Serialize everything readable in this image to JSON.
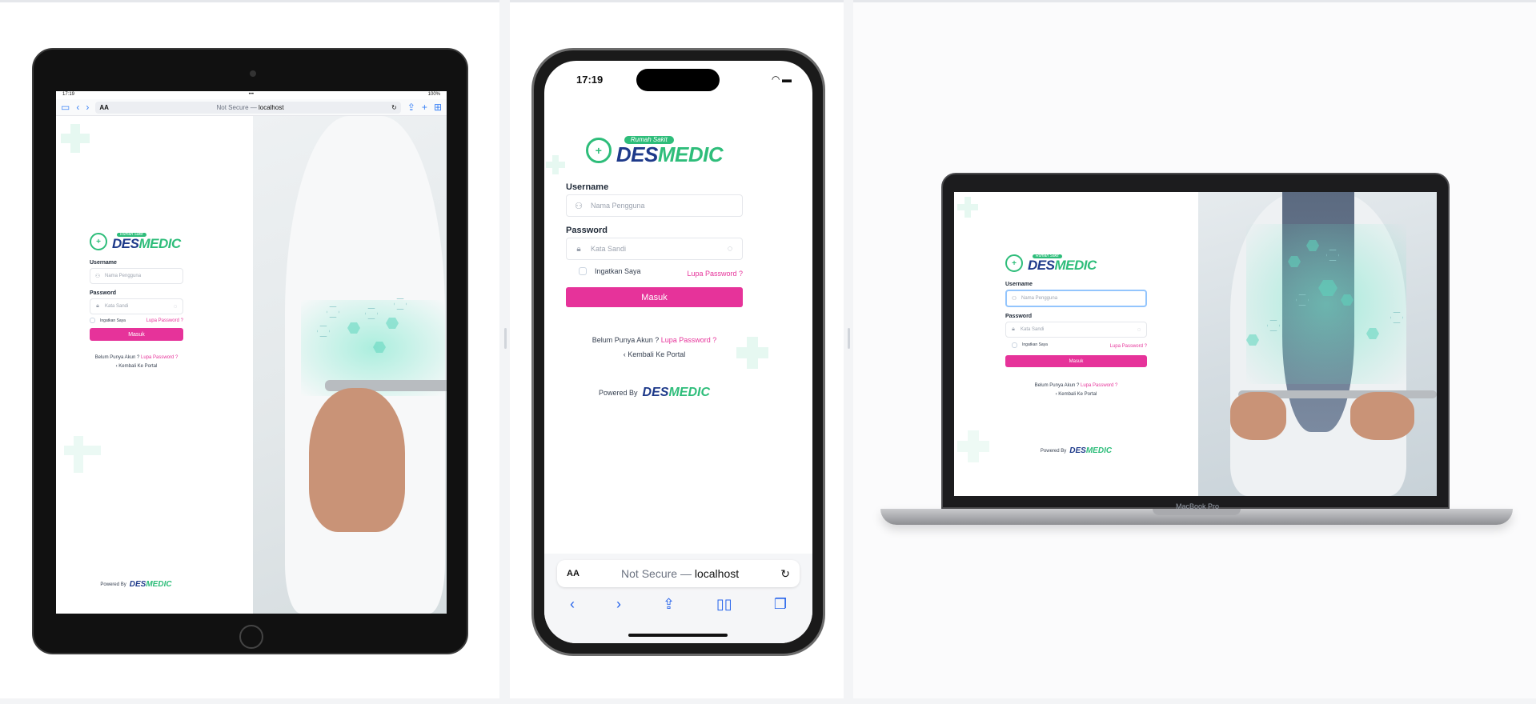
{
  "tablet": {
    "status_time": "17:19",
    "status_dots": "•••",
    "status_battery": "100%",
    "url_aa": "AA",
    "url_prefix": "Not Secure — ",
    "url_host": "localhost"
  },
  "phone": {
    "status_time": "17:19",
    "url_aa": "AA",
    "url_prefix": "Not Secure — ",
    "url_host": "localhost"
  },
  "laptop": {
    "model": "MacBook Pro"
  },
  "login": {
    "logo_tag": "Rumah Sakit",
    "logo_des": "DES",
    "logo_medic": "MEDIC",
    "username_label": "Username",
    "username_placeholder": "Nama Pengguna",
    "password_label": "Password",
    "password_placeholder": "Kata Sandi",
    "remember_label": "Ingatkan Saya",
    "forgot_link": "Lupa Password ?",
    "submit_label": "Masuk",
    "no_account_text": "Belum Punya Akun ?",
    "no_account_link": "Lupa Password ?",
    "back_link": "‹ Kembali Ke Portal",
    "powered_by": "Powered By",
    "powered_des": "DES",
    "powered_medic": "MEDIC"
  },
  "colors": {
    "accent_pink": "#e6339a",
    "brand_green": "#2ebd7a",
    "brand_navy": "#1e3a8a"
  }
}
